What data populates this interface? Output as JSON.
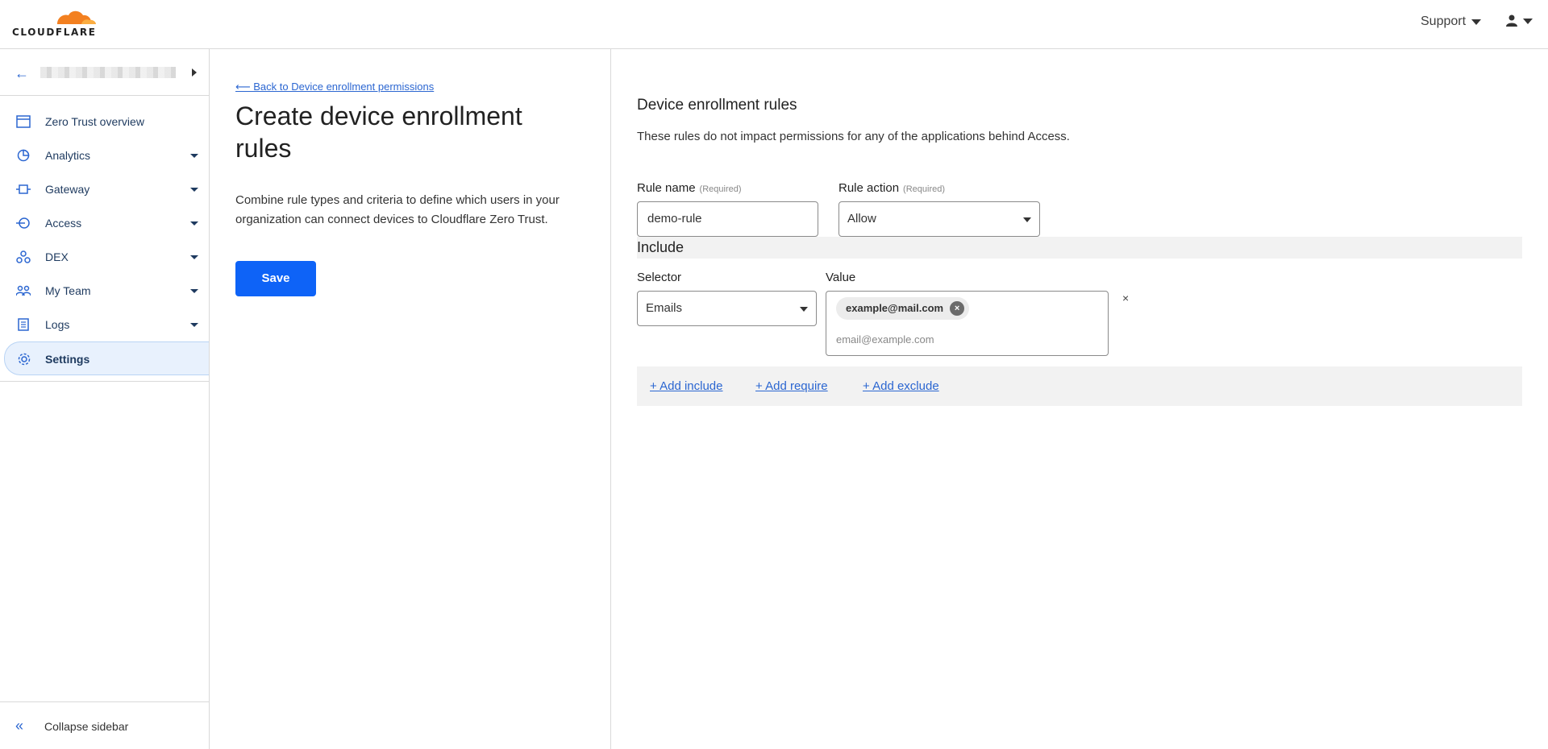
{
  "header": {
    "logo_text": "CLOUDFLARE",
    "support_label": "Support",
    "user_icon": "user-icon"
  },
  "sidebar": {
    "items": [
      {
        "label": "Zero Trust overview",
        "icon": "overview-icon",
        "has_dropdown": false
      },
      {
        "label": "Analytics",
        "icon": "analytics-icon",
        "has_dropdown": true
      },
      {
        "label": "Gateway",
        "icon": "gateway-icon",
        "has_dropdown": true
      },
      {
        "label": "Access",
        "icon": "access-icon",
        "has_dropdown": true
      },
      {
        "label": "DEX",
        "icon": "dex-icon",
        "has_dropdown": true
      },
      {
        "label": "My Team",
        "icon": "team-icon",
        "has_dropdown": true
      },
      {
        "label": "Logs",
        "icon": "logs-icon",
        "has_dropdown": true
      },
      {
        "label": "Settings",
        "icon": "gear-icon",
        "has_dropdown": false,
        "active": true
      }
    ],
    "collapse_label": "Collapse sidebar"
  },
  "middle": {
    "back_link": "⟵ Back to Device enrollment permissions",
    "title": "Create device enrollment rules",
    "description": "Combine rule types and criteria to define which users in your organization can connect devices to Cloudflare Zero Trust.",
    "save_label": "Save"
  },
  "form": {
    "section_title": "Device enrollment rules",
    "section_desc": "These rules do not impact permissions for any of the applications behind Access.",
    "rule_name_label": "Rule name",
    "rule_name_required": "(Required)",
    "rule_name_value": "demo-rule",
    "rule_action_label": "Rule action",
    "rule_action_required": "(Required)",
    "rule_action_value": "Allow",
    "include_label": "Include",
    "selector_label": "Selector",
    "selector_value": "Emails",
    "value_label": "Value",
    "value_chip": "example@mail.com",
    "value_placeholder": "email@example.com",
    "remove_symbol": "×",
    "add_include": "+ Add include",
    "add_require": "+ Add require",
    "add_exclude": "+ Add exclude"
  },
  "colors": {
    "accent": "#0e63f7",
    "link": "#2b66d1",
    "logo_orange": "#f38020"
  }
}
